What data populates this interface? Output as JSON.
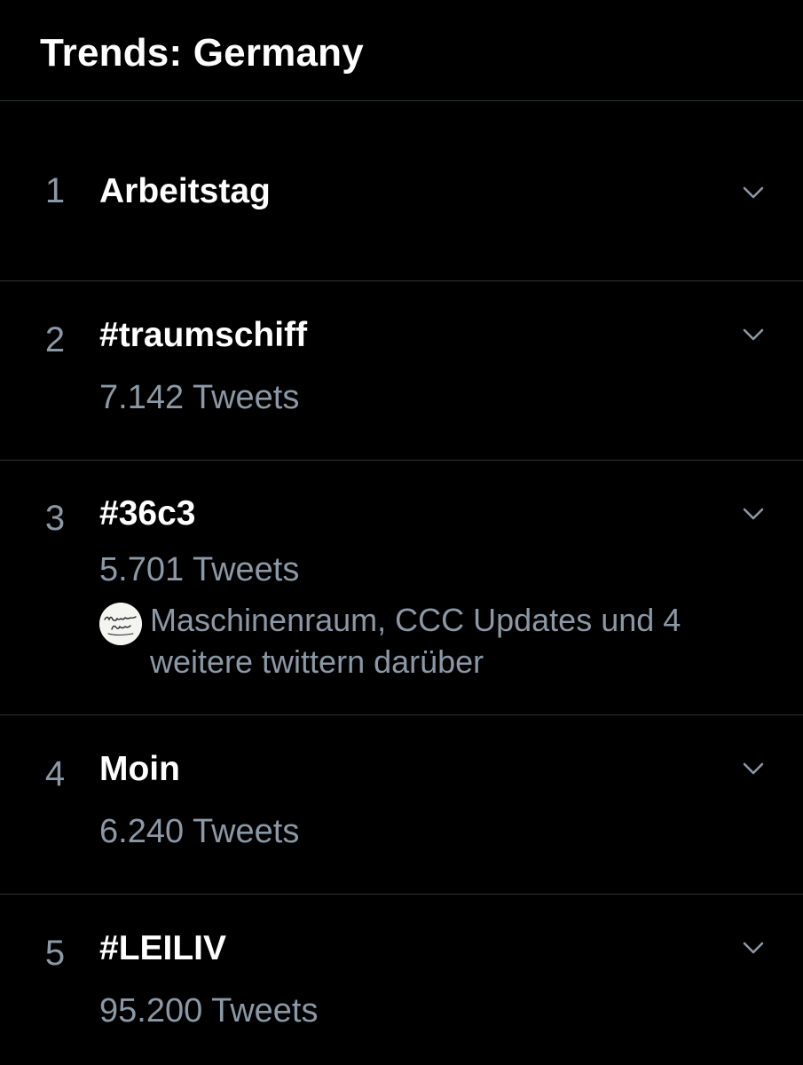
{
  "header": {
    "title": "Trends: Germany"
  },
  "trends": [
    {
      "rank": "1",
      "name": "Arbeitstag",
      "tweets": ""
    },
    {
      "rank": "2",
      "name": "#traumschiff",
      "tweets": "7.142 Tweets"
    },
    {
      "rank": "3",
      "name": "#36c3",
      "tweets": "5.701 Tweets",
      "context_line1": "Maschinenraum, CCC Updates und 4",
      "context_line2": "weitere twittern darüber"
    },
    {
      "rank": "4",
      "name": "Moin",
      "tweets": "6.240 Tweets"
    },
    {
      "rank": "5",
      "name": "#LEILIV",
      "tweets": "95.200 Tweets"
    }
  ],
  "icons": {
    "chevron": "chevron-down-icon",
    "avatar": "maschinenraum-avatar"
  },
  "colors": {
    "background": "#000000",
    "primary_text": "#ffffff",
    "secondary_text": "#8b98a5",
    "divider": "#2f3336"
  }
}
